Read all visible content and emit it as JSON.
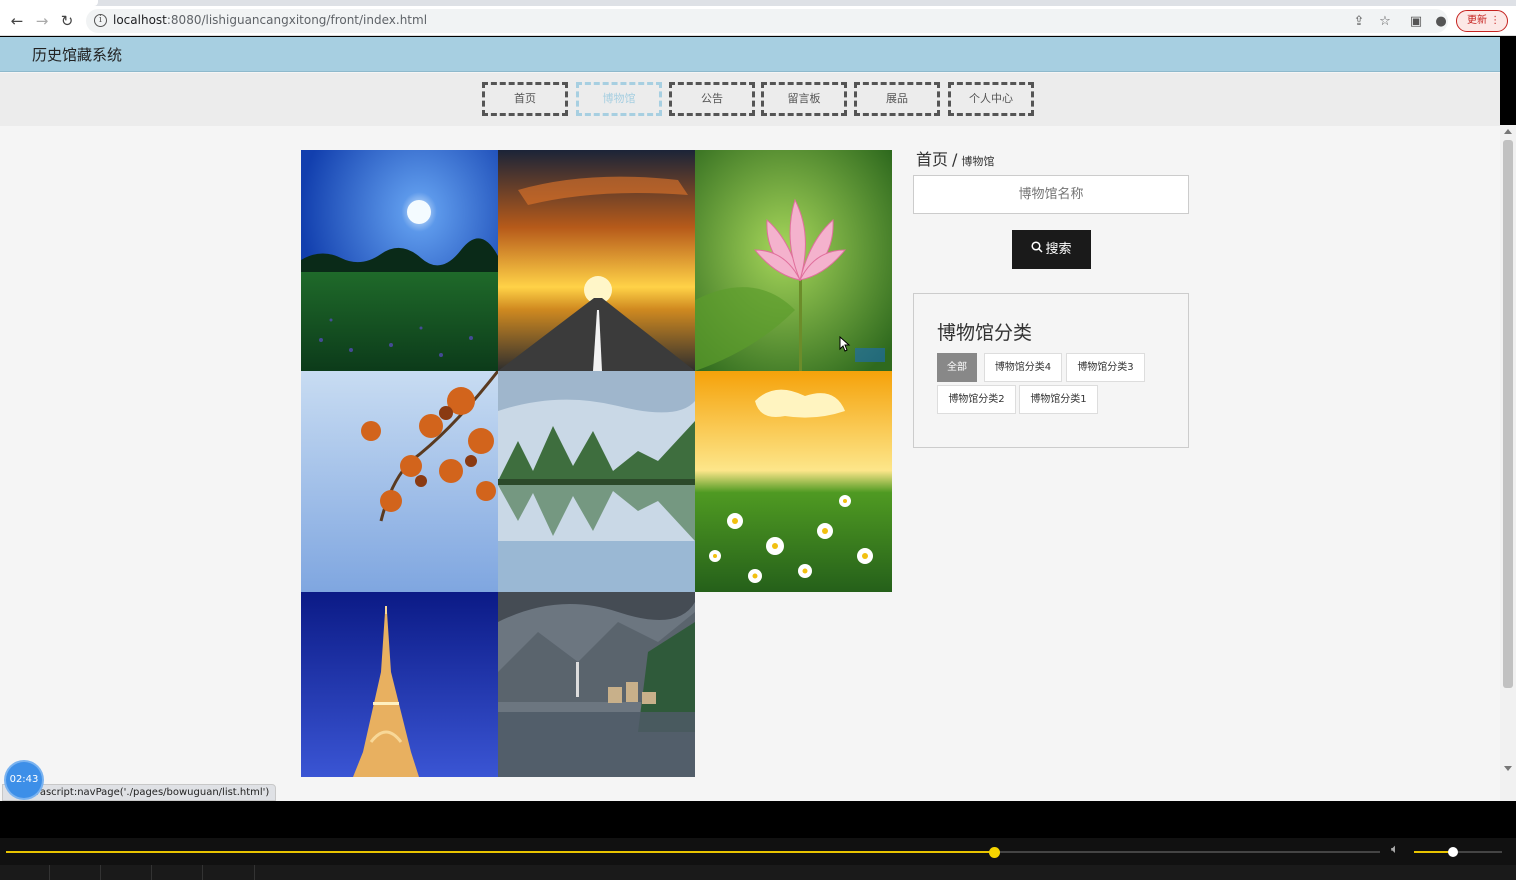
{
  "browser": {
    "url_host": "localhost",
    "url_path": ":8080/lishiguancangxitong/front/index.html",
    "update_label": "更新"
  },
  "site": {
    "title": "历史馆藏系统"
  },
  "nav": {
    "items": [
      {
        "label": "首页",
        "active": false
      },
      {
        "label": "博物馆",
        "active": true
      },
      {
        "label": "公告",
        "active": false
      },
      {
        "label": "留言板",
        "active": false
      },
      {
        "label": "展品",
        "active": false
      },
      {
        "label": "个人中心",
        "active": false
      }
    ]
  },
  "gallery": {
    "images": [
      {
        "subject": "moonlit-meadow",
        "colors": [
          "#1d4fc0",
          "#4f8be6",
          "#0e5a1e"
        ]
      },
      {
        "subject": "sunset-road",
        "colors": [
          "#1b2438",
          "#f39b1e",
          "#3a3a3a"
        ]
      },
      {
        "subject": "pink-lotus",
        "colors": [
          "#5a9c2a",
          "#9ccd4a",
          "#f2a4c4"
        ]
      },
      {
        "subject": "autumn-leaves",
        "colors": [
          "#b6d0ee",
          "#8fb3e4",
          "#d2641c"
        ]
      },
      {
        "subject": "karst-lake",
        "colors": [
          "#c6d6e6",
          "#3d6a3a",
          "#7fa2c6"
        ]
      },
      {
        "subject": "daisy-field",
        "colors": [
          "#f7b81a",
          "#fce58b",
          "#3f8a1e"
        ]
      },
      {
        "subject": "eiffel-tower",
        "colors": [
          "#0a1c8c",
          "#2b46c8",
          "#f0c070"
        ]
      },
      {
        "subject": "mountain-village",
        "colors": [
          "#4a5560",
          "#7d8790",
          "#2f5a3a"
        ]
      }
    ]
  },
  "sidebar": {
    "breadcrumb_home": "首页",
    "breadcrumb_sep": "/",
    "breadcrumb_current": "博物馆",
    "search_placeholder": "博物馆名称",
    "search_button": "搜索",
    "category_title": "博物馆分类",
    "categories": [
      {
        "label": "全部",
        "active": true
      },
      {
        "label": "博物馆分类4",
        "active": false
      },
      {
        "label": "博物馆分类3",
        "active": false
      },
      {
        "label": "博物馆分类2",
        "active": false
      },
      {
        "label": "博物馆分类1",
        "active": false
      }
    ]
  },
  "status": {
    "link_text": "javascript:navPage('./pages/bowuguan/list.html')",
    "timer": "02:43"
  },
  "player": {
    "progress": 0.719,
    "volume": 0.44,
    "accent_color": "#e8c400"
  }
}
